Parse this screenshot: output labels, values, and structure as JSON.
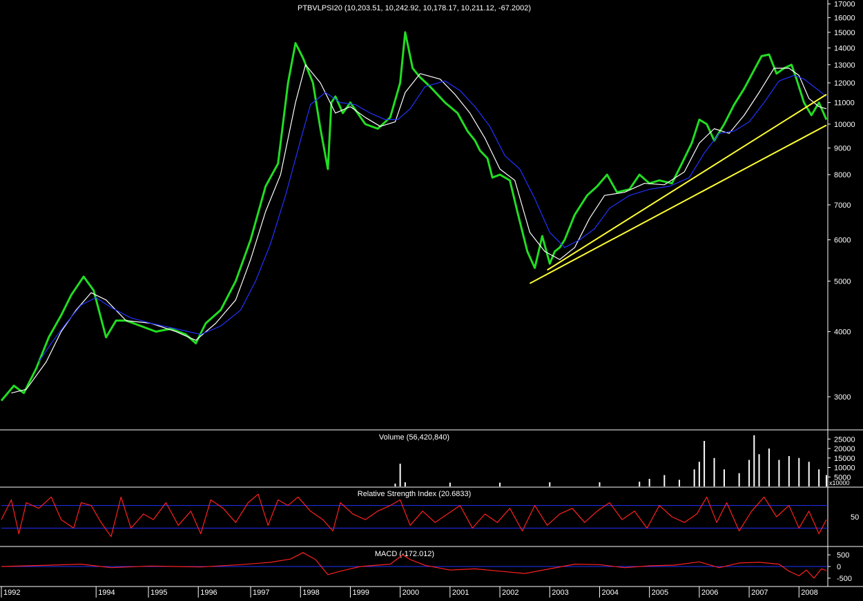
{
  "chart_data": [
    {
      "type": "line",
      "title": "PTBVLPSI20 (10,203.51, 10,242.92, 10,178.17, 10,211.12, -67.2002)",
      "y_scale": "log",
      "ylim": [
        2600,
        17300
      ],
      "yticks": [
        3000,
        4000,
        5000,
        6000,
        7000,
        8000,
        9000,
        10000,
        11000,
        12000,
        13000,
        14000,
        15000,
        16000,
        17000
      ],
      "x_range": [
        1992.0,
        2008.55
      ],
      "series": [
        {
          "color": "#22dd22",
          "x": [
            1992.0,
            1992.25,
            1992.45,
            1992.7,
            1992.95,
            1993.2,
            1993.4,
            1993.65,
            1993.85,
            1994.1,
            1994.3,
            1994.5,
            1994.8,
            1995.1,
            1995.4,
            1995.7,
            1995.9,
            1996.1,
            1996.4,
            1996.7,
            1997.0,
            1997.3,
            1997.55,
            1997.75,
            1997.9,
            1998.05,
            1998.25,
            1998.4,
            1998.55,
            1998.62,
            1998.7,
            1998.85,
            1999.0,
            1999.3,
            1999.55,
            1999.8,
            2000.0,
            2000.1,
            2000.25,
            2000.4,
            2000.6,
            2000.9,
            2001.15,
            2001.35,
            2001.5,
            2001.6,
            2001.75,
            2001.85,
            2002.0,
            2002.2,
            2002.35,
            2002.55,
            2002.7,
            2002.85,
            2003.0,
            2003.1,
            2003.2,
            2003.3,
            2003.5,
            2003.75,
            2003.95,
            2004.15,
            2004.35,
            2004.6,
            2004.8,
            2005.0,
            2005.2,
            2005.45,
            2005.65,
            2005.85,
            2006.0,
            2006.15,
            2006.3,
            2006.5,
            2006.7,
            2006.9,
            2007.1,
            2007.25,
            2007.4,
            2007.55,
            2007.7,
            2007.85,
            2007.95,
            2008.1,
            2008.25,
            2008.4,
            2008.55
          ],
          "values": [
            2950,
            3150,
            3050,
            3400,
            3900,
            4300,
            4700,
            5100,
            4800,
            3900,
            4200,
            4200,
            4100,
            4000,
            4050,
            3950,
            3800,
            4150,
            4400,
            5000,
            6000,
            7600,
            8400,
            12000,
            14300,
            13400,
            12000,
            9800,
            8200,
            11000,
            11300,
            10500,
            11000,
            10000,
            9800,
            10300,
            12000,
            15000,
            12800,
            12300,
            11800,
            11000,
            10500,
            9700,
            9300,
            8900,
            8600,
            7900,
            8000,
            7800,
            6800,
            5700,
            5300,
            6100,
            5400,
            5700,
            5800,
            6000,
            6700,
            7300,
            7600,
            8000,
            7400,
            7500,
            8000,
            7700,
            7800,
            7700,
            8400,
            9200,
            10200,
            10000,
            9300,
            10000,
            10900,
            11700,
            12700,
            13500,
            13600,
            12500,
            12800,
            13000,
            12200,
            11000,
            10400,
            11000,
            10200
          ]
        },
        {
          "color": "#ffffff",
          "x": [
            1992.2,
            1992.5,
            1992.9,
            1993.2,
            1993.5,
            1993.8,
            1994.1,
            1994.5,
            1995.0,
            1995.5,
            1995.9,
            1996.3,
            1996.7,
            1997.0,
            1997.3,
            1997.6,
            1997.9,
            1998.1,
            1998.4,
            1998.7,
            1999.0,
            1999.3,
            1999.6,
            1999.9,
            2000.1,
            2000.4,
            2000.8,
            2001.1,
            2001.4,
            2001.7,
            2002.0,
            2002.3,
            2002.6,
            2002.9,
            2003.2,
            2003.5,
            2003.8,
            2004.1,
            2004.5,
            2004.9,
            2005.3,
            2005.7,
            2006.0,
            2006.3,
            2006.6,
            2006.9,
            2007.2,
            2007.5,
            2007.8,
            2008.0,
            2008.2,
            2008.4,
            2008.55
          ],
          "values": [
            3050,
            3100,
            3500,
            4000,
            4400,
            4750,
            4600,
            4200,
            4150,
            4000,
            3850,
            4150,
            4600,
            5500,
            6800,
            8000,
            11000,
            13000,
            12000,
            10500,
            10800,
            10300,
            9900,
            10100,
            11500,
            12500,
            12200,
            11400,
            10500,
            9400,
            8200,
            7800,
            6200,
            5700,
            5500,
            5800,
            6600,
            7300,
            7400,
            7700,
            7650,
            8100,
            9200,
            9800,
            9600,
            10400,
            11500,
            12800,
            12800,
            12400,
            11200,
            10800,
            10700
          ]
        },
        {
          "color": "#2233ff",
          "x": [
            1992.75,
            1993.0,
            1993.3,
            1993.6,
            1993.9,
            1994.2,
            1994.6,
            1995.0,
            1995.5,
            1996.0,
            1996.4,
            1996.8,
            1997.1,
            1997.4,
            1997.7,
            1998.0,
            1998.2,
            1998.5,
            1998.8,
            1999.1,
            1999.4,
            1999.7,
            1999.95,
            2000.2,
            2000.5,
            2000.9,
            2001.2,
            2001.5,
            2001.8,
            2002.1,
            2002.4,
            2002.7,
            2003.0,
            2003.3,
            2003.6,
            2003.9,
            2004.2,
            2004.6,
            2005.0,
            2005.4,
            2005.8,
            2006.1,
            2006.4,
            2006.7,
            2007.0,
            2007.3,
            2007.6,
            2007.9,
            2008.1,
            2008.3,
            2008.55
          ],
          "values": [
            3500,
            3800,
            4150,
            4500,
            4650,
            4450,
            4250,
            4150,
            4050,
            3950,
            4100,
            4400,
            5000,
            5900,
            7300,
            9300,
            10900,
            11500,
            11000,
            10900,
            10500,
            10200,
            10200,
            10700,
            11800,
            12100,
            11600,
            10800,
            9900,
            8700,
            8200,
            7200,
            6200,
            5800,
            6000,
            6300,
            6900,
            7300,
            7500,
            7600,
            7900,
            8800,
            9600,
            9700,
            10100,
            11000,
            12100,
            12400,
            12200,
            11800,
            11300
          ]
        }
      ],
      "trendlines": [
        {
          "color": "#ffff33",
          "x": [
            2002.6,
            2008.55
          ],
          "values": [
            4950,
            9950
          ]
        },
        {
          "color": "#ffff33",
          "x": [
            2002.95,
            2008.55
          ],
          "values": [
            5250,
            11400
          ]
        }
      ]
    },
    {
      "type": "bar",
      "title": "Volume (56,420,840)",
      "yticks": [
        5000,
        10000,
        15000,
        20000,
        25000
      ],
      "ytick_labels": [
        "5000",
        "10000",
        "15000",
        "20000",
        "25000"
      ],
      "ylim": [
        0,
        28000
      ],
      "unit_label": "x10000",
      "x": [
        1992.0,
        1999.85,
        1999.9,
        2000.0,
        2000.1,
        2001.0,
        2002.0,
        2003.0,
        2004.0,
        2004.8,
        2005.0,
        2005.3,
        2005.6,
        2005.9,
        2006.0,
        2006.1,
        2006.3,
        2006.5,
        2006.8,
        2007.0,
        2007.1,
        2007.2,
        2007.4,
        2007.6,
        2007.8,
        2008.0,
        2008.2,
        2008.4,
        2008.55
      ],
      "values": [
        0,
        0,
        1500,
        12000,
        2200,
        2000,
        2000,
        2200,
        2200,
        2500,
        4000,
        6000,
        3500,
        9000,
        13000,
        24000,
        15000,
        9000,
        7000,
        14000,
        27000,
        17000,
        20000,
        14000,
        16000,
        15000,
        13000,
        9000,
        6000
      ]
    },
    {
      "type": "line",
      "title": "Relative Strength Index (20.6833)",
      "ylim": [
        0,
        100
      ],
      "yticks": [
        50
      ],
      "levels": [
        70,
        30
      ],
      "series": [
        {
          "color": "#ff2020",
          "x": [
            1992.0,
            1992.2,
            1992.35,
            1992.5,
            1992.75,
            1993.0,
            1993.2,
            1993.45,
            1993.6,
            1993.8,
            1994.0,
            1994.2,
            1994.4,
            1994.6,
            1994.85,
            1995.05,
            1995.3,
            1995.55,
            1995.8,
            1996.0,
            1996.2,
            1996.45,
            1996.7,
            1996.95,
            1997.15,
            1997.35,
            1997.55,
            1997.75,
            1997.95,
            1998.2,
            1998.45,
            1998.65,
            1998.8,
            1999.05,
            1999.3,
            1999.55,
            1999.8,
            2000.0,
            2000.2,
            2000.45,
            2000.7,
            2000.95,
            2001.2,
            2001.45,
            2001.7,
            2001.95,
            2002.2,
            2002.45,
            2002.7,
            2002.95,
            2003.2,
            2003.45,
            2003.7,
            2003.95,
            2004.2,
            2004.45,
            2004.7,
            2004.95,
            2005.2,
            2005.45,
            2005.7,
            2005.95,
            2006.15,
            2006.35,
            2006.55,
            2006.8,
            2007.05,
            2007.3,
            2007.55,
            2007.8,
            2008.0,
            2008.2,
            2008.4,
            2008.55
          ],
          "values": [
            45,
            80,
            20,
            75,
            65,
            85,
            45,
            30,
            75,
            70,
            40,
            15,
            85,
            30,
            55,
            45,
            75,
            35,
            60,
            20,
            80,
            65,
            40,
            75,
            90,
            35,
            80,
            70,
            85,
            60,
            45,
            25,
            75,
            55,
            45,
            60,
            70,
            80,
            35,
            60,
            40,
            55,
            70,
            30,
            55,
            40,
            65,
            25,
            70,
            35,
            55,
            65,
            40,
            60,
            75,
            45,
            60,
            30,
            70,
            50,
            40,
            55,
            85,
            40,
            75,
            25,
            60,
            85,
            50,
            70,
            30,
            60,
            20,
            45
          ]
        }
      ]
    },
    {
      "type": "line",
      "title": "MACD (-172.012)",
      "ylim": [
        -800,
        800
      ],
      "yticks": [
        500,
        0,
        -500
      ],
      "ytick_labels": [
        "500",
        "0",
        "-500"
      ],
      "series": [
        {
          "color": "#ff2020",
          "x": [
            1992.0,
            1993.0,
            1993.6,
            1994.2,
            1995.0,
            1996.0,
            1996.8,
            1997.4,
            1997.8,
            1998.05,
            1998.3,
            1998.55,
            1998.8,
            1999.2,
            1999.8,
            2000.05,
            2000.2,
            2000.5,
            2001.0,
            2001.5,
            2002.0,
            2002.5,
            2003.0,
            2003.5,
            2004.0,
            2004.5,
            2005.0,
            2005.5,
            2006.0,
            2006.4,
            2006.8,
            2007.2,
            2007.6,
            2007.8,
            2008.0,
            2008.15,
            2008.3,
            2008.45,
            2008.55
          ],
          "values": [
            0,
            60,
            100,
            -50,
            20,
            -20,
            80,
            180,
            320,
            600,
            300,
            -350,
            -200,
            0,
            100,
            500,
            300,
            50,
            -150,
            -100,
            -200,
            -300,
            -100,
            100,
            80,
            -50,
            30,
            60,
            200,
            -50,
            150,
            180,
            100,
            -200,
            -400,
            -150,
            -500,
            -100,
            -172
          ]
        }
      ]
    }
  ],
  "x_axis": {
    "tick_labels": [
      "1992",
      "1994",
      "1995",
      "1996",
      "1997",
      "1998",
      "1999",
      "2000",
      "2001",
      "2002",
      "2003",
      "2004",
      "2005",
      "2006",
      "2007",
      "2008"
    ],
    "tick_values": [
      1992.0,
      1993.9,
      1994.95,
      1995.95,
      1997.0,
      1998.0,
      1999.0,
      2000.0,
      2001.0,
      2002.0,
      2003.0,
      2004.0,
      2005.0,
      2006.0,
      2007.0,
      2008.0
    ]
  }
}
